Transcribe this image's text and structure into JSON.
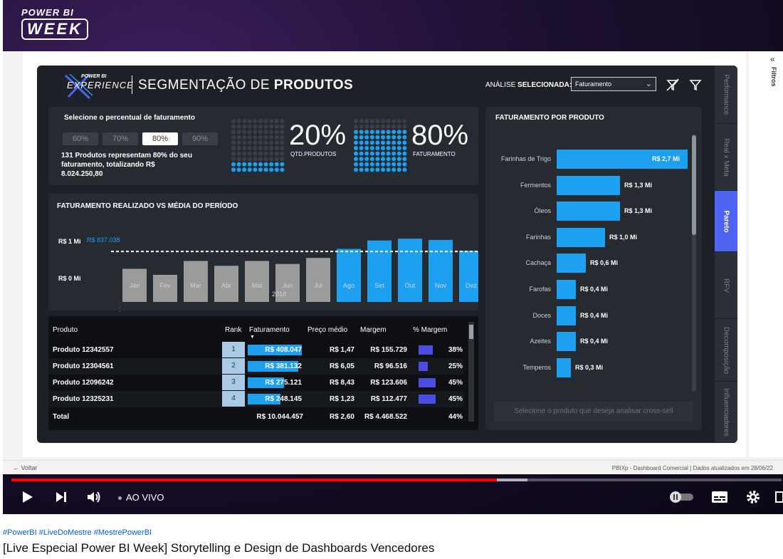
{
  "brand": {
    "pbi_week_line1": "POWER BI",
    "pbi_week_line2": "WEEK",
    "experience_small": "POWER BI",
    "experience_big": "EXPERIENCE"
  },
  "header": {
    "title_normal": "SEGMENTAÇÃO DE ",
    "title_bold": "PRODUTOS",
    "analise_label": "ANÁLISE ",
    "analise_label_bold": "SELECIONADA:",
    "analise_value": "Faturamento"
  },
  "segment": {
    "title": "Selecione o percentual de faturamento",
    "options": [
      "60%",
      "70%",
      "80%",
      "90%"
    ],
    "selected": "80%",
    "summary": "131 Produtos representam 80% do seu faturamento, totalizando R$ 8.024.250,80",
    "kpi1_value": "20%",
    "kpi1_label": "QTD.PRODUTOS",
    "kpi2_value": "80%",
    "kpi2_label": "FATURAMENTO"
  },
  "monthly": {
    "title": "FATURAMENTO REALIZADO VS MÉDIA DO PERÍODO",
    "y_top_label": "R$ 1 Mi",
    "y_bottom_label": "R$ 0 Mi",
    "avg_label": "R$ 837.038",
    "year_label": "2018"
  },
  "chart_data": [
    {
      "type": "bar",
      "title": "FATURAMENTO REALIZADO VS MÉDIA DO PERÍODO",
      "categories": [
        "Jan",
        "Fev",
        "Mar",
        "Abr",
        "Mai",
        "Jun",
        "Jul",
        "Ago",
        "Set",
        "Out",
        "Nov",
        "Dez"
      ],
      "values": [
        0.55,
        0.45,
        0.68,
        0.6,
        0.68,
        0.63,
        0.73,
        0.88,
        1.02,
        1.05,
        1.03,
        0.85
      ],
      "highlight_from_index": 7,
      "average": 0.837038,
      "ylabel": "",
      "ylim": [
        0,
        1.3
      ],
      "colors": {
        "base": "#9b9b9b",
        "highlight": "#1ea0f0",
        "average_line": "#ffffff"
      }
    },
    {
      "type": "bar",
      "title": "FATURAMENTO POR PRODUTO",
      "orientation": "horizontal",
      "categories": [
        "Farinhas de Trigo",
        "Fermentos",
        "Óleos",
        "Farinhas",
        "Cachaça",
        "Farofas",
        "Doces",
        "Azeites",
        "Temperos"
      ],
      "values": [
        2.7,
        1.3,
        1.3,
        1.0,
        0.6,
        0.4,
        0.4,
        0.4,
        0.3
      ],
      "labels": [
        "R$ 2,7 Mi",
        "R$ 1,3 Mi",
        "R$ 1,3 Mi",
        "R$ 1,0 Mi",
        "R$ 0,6 Mi",
        "R$ 0,4 Mi",
        "R$ 0,4 Mi",
        "R$ 0,4 Mi",
        "R$ 0,3 Mi"
      ],
      "xlim": [
        0,
        2.7
      ],
      "colors": {
        "bar": "#1ea0f0"
      }
    }
  ],
  "table": {
    "headers": [
      "Produto",
      "Rank",
      "Faturamento",
      "Preço médio",
      "Margem",
      "% Margem"
    ],
    "rows": [
      {
        "produto": "Produto 12342557",
        "rank": "1",
        "faturamento": "R$ 408.047",
        "fat_fraction": 1.0,
        "preco": "R$ 1,47",
        "margem": "R$ 155.729",
        "pct": "38%",
        "pct_value": 38
      },
      {
        "produto": "Produto 12304561",
        "rank": "2",
        "faturamento": "R$ 381.132",
        "fat_fraction": 0.93,
        "preco": "R$ 6,05",
        "margem": "R$ 96.516",
        "pct": "25%",
        "pct_value": 25
      },
      {
        "produto": "Produto 12096242",
        "rank": "3",
        "faturamento": "R$ 275.121",
        "fat_fraction": 0.67,
        "preco": "R$ 8,43",
        "margem": "R$ 123.606",
        "pct": "45%",
        "pct_value": 45
      },
      {
        "produto": "Produto 12325231",
        "rank": "4",
        "faturamento": "R$ 248.145",
        "fat_fraction": 0.61,
        "preco": "R$ 1,23",
        "margem": "R$ 112.477",
        "pct": "45%",
        "pct_value": 45
      }
    ],
    "total": {
      "label": "Total",
      "faturamento": "R$ 10.044.457",
      "preco": "R$ 2,60",
      "margem": "R$ 4.468.522",
      "pct": "44%"
    }
  },
  "right_panel": {
    "title": "FATURAMENTO POR PRODUTO",
    "cross_sell": "Selecione o produto que deseja analisar cross-sell"
  },
  "side_tabs": [
    "Performance",
    "Real x Meta",
    "Pareto",
    "RFV",
    "Decomposição",
    "Influenciadores"
  ],
  "side_tabs_active": "Pareto",
  "filters_label": "Filtros",
  "statusbar": {
    "voltar": "Voltar",
    "right": "PBIXp - Dashboard Comercial  |  Dados atualizados em 28/06/22"
  },
  "player": {
    "live_label": "AO VIVO",
    "progress": 0.63,
    "buffer_end": 0.67
  },
  "below": {
    "hashtags": "#PowerBI #LiveDoMestre #MestrePowerBI",
    "title": "[Live Especial Power BI Week] Storytelling e Design de Dashboards Vencedores"
  },
  "colors": {
    "accent_blue": "#1ea0f0",
    "accent_purple": "#4e63f1",
    "youtube_red": "#ff0000",
    "canvas_bg": "#1d2127"
  }
}
